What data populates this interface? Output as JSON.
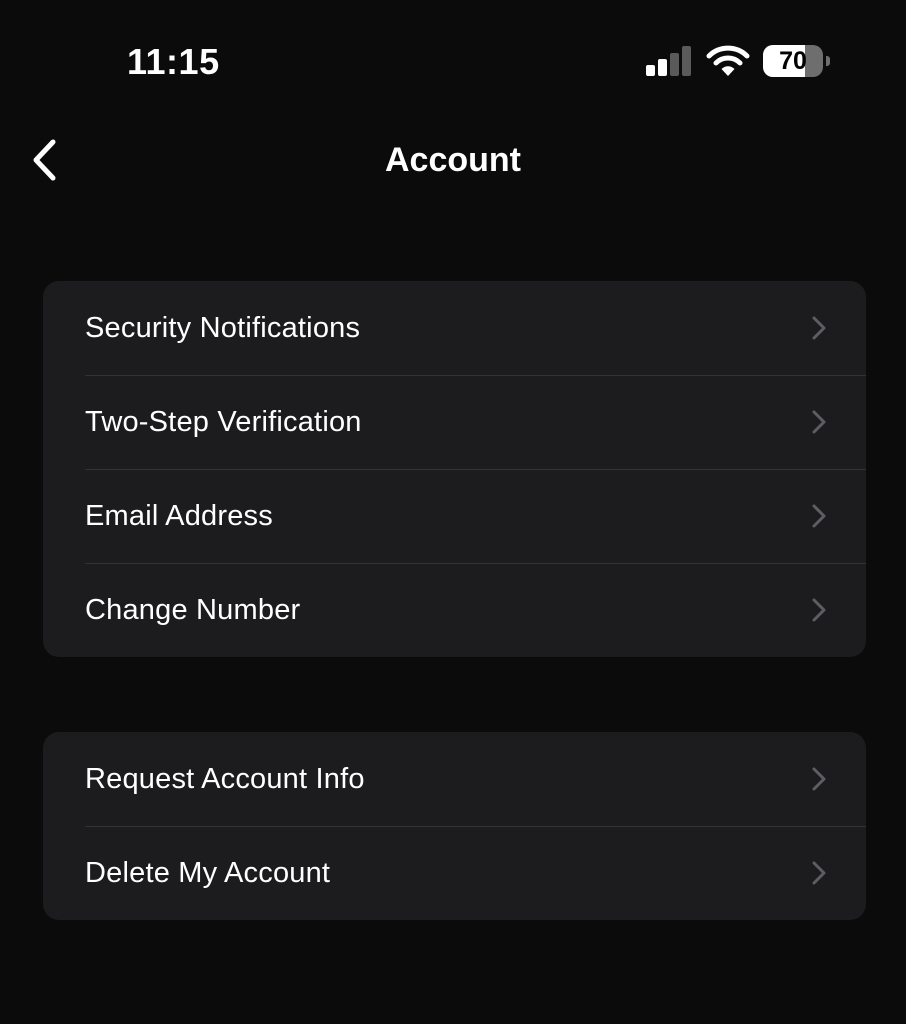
{
  "status_bar": {
    "time": "11:15",
    "signal_bars_active": 2,
    "signal_bars_total": 4,
    "battery_percent": "70",
    "battery_level": 0.7,
    "icons": [
      "cellular-signal-icon",
      "wifi-icon",
      "battery-icon"
    ]
  },
  "nav": {
    "title": "Account",
    "back_icon": "chevron-left-icon"
  },
  "groups": [
    {
      "items": [
        {
          "label": "Security Notifications",
          "icon": "chevron-right-icon"
        },
        {
          "label": "Two-Step Verification",
          "icon": "chevron-right-icon"
        },
        {
          "label": "Email Address",
          "icon": "chevron-right-icon"
        },
        {
          "label": "Change Number",
          "icon": "chevron-right-icon"
        }
      ]
    },
    {
      "items": [
        {
          "label": "Request Account Info",
          "icon": "chevron-right-icon"
        },
        {
          "label": "Delete My Account",
          "icon": "chevron-right-icon"
        }
      ]
    }
  ],
  "colors": {
    "background": "#0b0b0b",
    "group_background": "#1c1c1e",
    "separator": "#333335",
    "text": "#ffffff",
    "chevron": "#5e5e62"
  }
}
